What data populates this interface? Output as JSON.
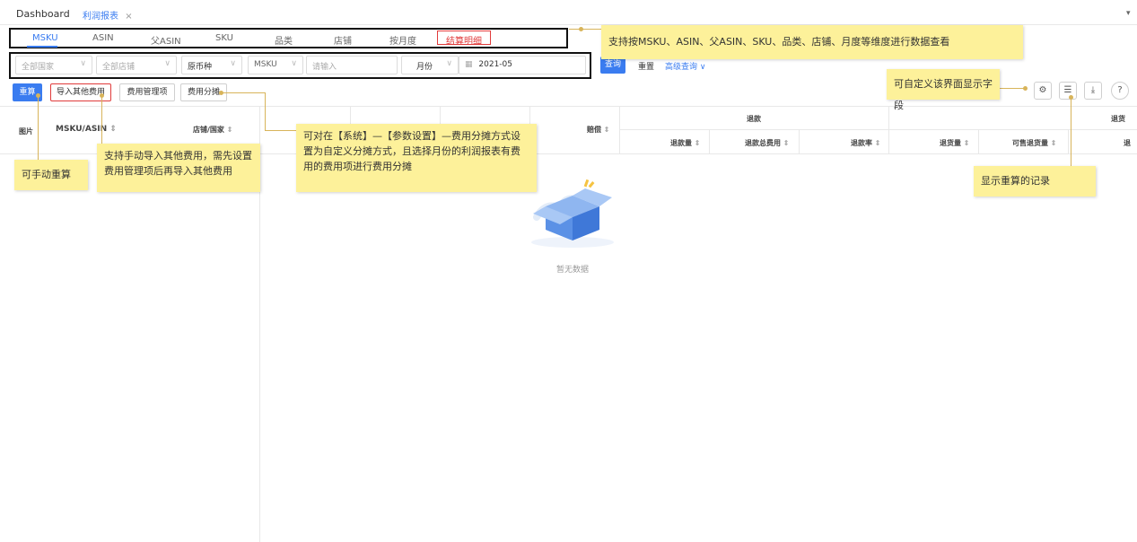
{
  "top_tabs": [
    {
      "label": "Dashboard"
    },
    {
      "label": "利润报表",
      "close": "×"
    }
  ],
  "top_right_caret": "▾",
  "dimension_tabs": [
    "MSKU",
    "ASIN",
    "父ASIN",
    "SKU",
    "品类",
    "店铺",
    "按月度",
    "结算明细"
  ],
  "filters": {
    "country": "全部国家",
    "store": "全部店铺",
    "currency": "原币种",
    "search_type": "MSKU",
    "search_placeholder": "请输入",
    "period_type": "月份",
    "month": "2021-05",
    "query_button": "查询",
    "reset_button": "重置",
    "advanced": "高级查询"
  },
  "actions": {
    "recalc": "重算",
    "import_other_fees": "导入其他费用",
    "fee_management": "费用管理项",
    "fee_allocation": "费用分摊"
  },
  "table": {
    "col_image": "图片",
    "col_msku": "MSKU/ASIN",
    "col_store": "店铺/国家",
    "col_compensation": "赔偿",
    "group_refund": "退款",
    "col_refund_qty": "退款量",
    "col_refund_total_fee": "退款总费用",
    "col_refund_rate": "退款率",
    "group_return": "退货",
    "col_return_qty": "退货量",
    "col_sellable_return": "可售退货量",
    "col_return_cut": "退",
    "sort_glyph": "⇕"
  },
  "empty_text": "暂无数据",
  "annotations": {
    "dimensions": "支持按MSKU、ASIN、父ASIN、SKU、品类、店铺、月度等维度进行数据查看",
    "custom_fields": "可自定义该界面显示字段",
    "manual_recalc": "可手动重算",
    "import_fees": "支持手动导入其他费用，需先设置费用管理项后再导入其他费用",
    "allocation": "可对在【系统】—【参数设置】—费用分摊方式设置为自定义分摊方式，且选择月份的利润报表有费用的费用项进行费用分摊",
    "recalc_records": "显示重算的记录"
  },
  "icons": [
    "settings-icon",
    "list-icon",
    "download-icon",
    "help-icon"
  ],
  "colors": {
    "accent": "#3a7cf0",
    "note": "#fdf19a",
    "highlight_red": "#e03b3b"
  }
}
